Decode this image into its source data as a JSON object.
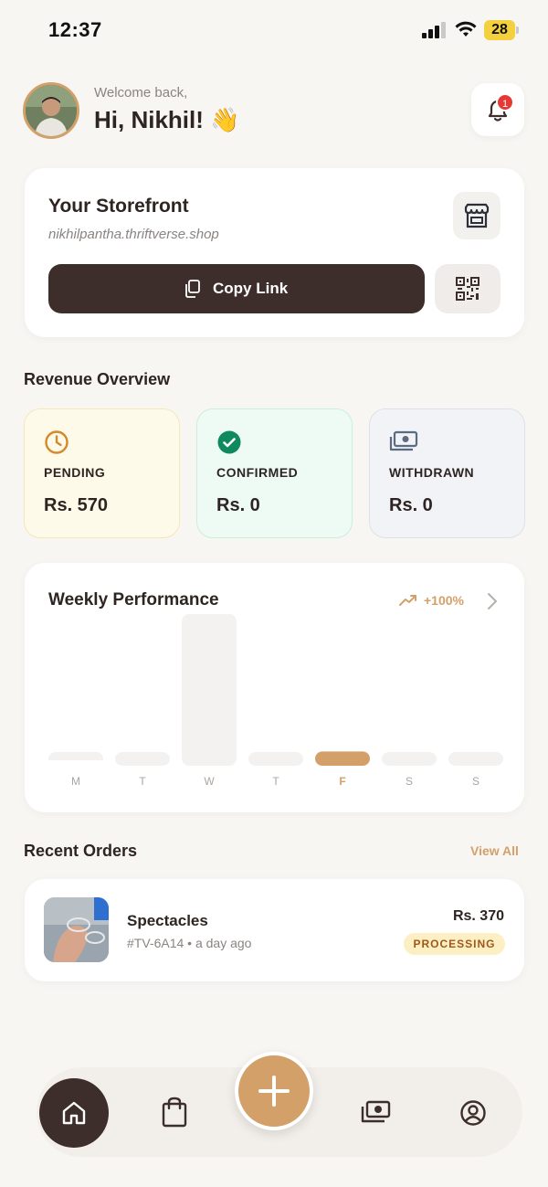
{
  "status_bar": {
    "time": "12:37",
    "battery": "28",
    "icons": [
      "signal-icon",
      "wifi-icon",
      "battery-icon"
    ]
  },
  "header": {
    "welcome": "Welcome back,",
    "greeting": "Hi, Nikhil! 👋",
    "notification_count": "1"
  },
  "storefront": {
    "title": "Your Storefront",
    "url": "nikhilpantha.thriftverse.shop",
    "copy_label": "Copy Link"
  },
  "revenue": {
    "title": "Revenue Overview",
    "cards": [
      {
        "label": "PENDING",
        "value": "Rs. 570",
        "icon": "clock-icon",
        "bg": "#fefaea",
        "border": "#f6e6b8"
      },
      {
        "label": "CONFIRMED",
        "value": "Rs. 0",
        "icon": "check-circle-icon",
        "bg": "#edfbf4",
        "border": "#c9efda"
      },
      {
        "label": "WITHDRAWN",
        "value": "Rs. 0",
        "icon": "cash-icon",
        "bg": "#f1f3f6",
        "border": "#dde1e7"
      }
    ]
  },
  "weekly": {
    "title": "Weekly Performance",
    "trend": "+100%"
  },
  "chart_data": {
    "type": "bar",
    "categories": [
      "M",
      "T",
      "W",
      "T",
      "F",
      "S",
      "S"
    ],
    "values": [
      0,
      0,
      1,
      0,
      0.06,
      0,
      0
    ],
    "highlight_index": 4,
    "colors": {
      "bar": "#f3f2f0",
      "highlight": "#d4a06a",
      "label": "#aaa5a0",
      "label_highlight": "#d4a06a"
    }
  },
  "orders": {
    "title": "Recent Orders",
    "view_all": "View All",
    "items": [
      {
        "name": "Spectacles",
        "meta": "#TV-6A14 • a day ago",
        "price": "Rs. 370",
        "status": "PROCESSING"
      }
    ]
  },
  "nav": {
    "items": [
      "home-icon",
      "bag-icon",
      "plus-icon",
      "cash-icon",
      "profile-icon"
    ]
  },
  "colors": {
    "accent": "#d4a06a",
    "dark": "#3d2e2c",
    "background": "#f8f6f2"
  }
}
